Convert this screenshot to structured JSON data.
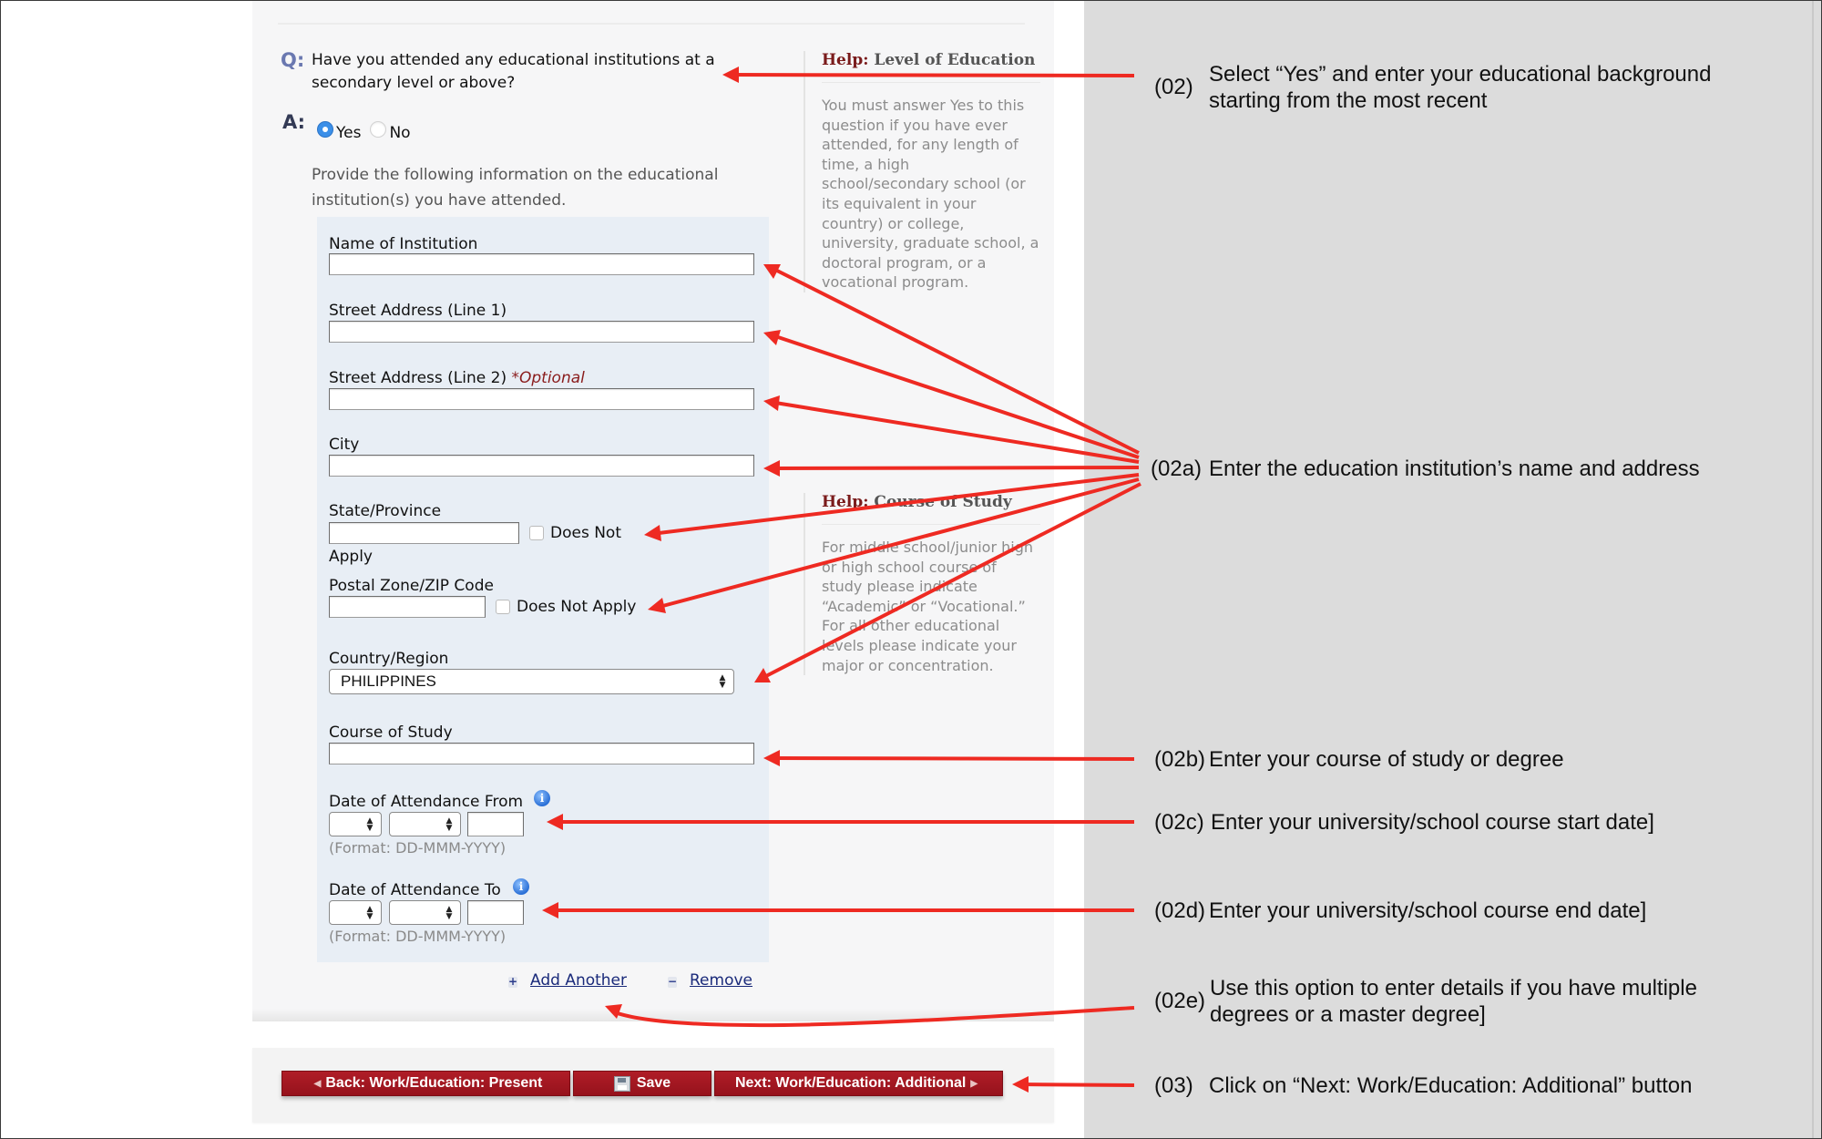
{
  "form": {
    "question_label": "Q:",
    "question": "Have you attended any educational institutions at a secondary level or above?",
    "answer_label": "A:",
    "options": [
      {
        "label": "Yes",
        "selected": true
      },
      {
        "label": "No",
        "selected": false
      }
    ],
    "instructions": "Provide the following information on the educational institution(s) you have attended.",
    "fields": {
      "institution_name": {
        "label": "Name of Institution",
        "value": ""
      },
      "street1": {
        "label": "Street Address (Line 1)",
        "value": ""
      },
      "street2": {
        "label": "Street Address (Line 2)",
        "optional_tag": "*Optional",
        "value": ""
      },
      "city": {
        "label": "City",
        "value": ""
      },
      "state": {
        "label": "State/Province",
        "value": "",
        "does_not_apply_label_1": "Does Not",
        "does_not_apply_label_2": "Apply",
        "does_not_apply_checked": false
      },
      "postal": {
        "label": "Postal Zone/ZIP Code",
        "value": "",
        "does_not_apply_label": "Does Not Apply",
        "does_not_apply_checked": false
      },
      "country": {
        "label": "Country/Region",
        "value": "PHILIPPINES"
      },
      "course": {
        "label": "Course of Study",
        "value": ""
      },
      "date_from": {
        "label": "Date of Attendance From",
        "day": "",
        "month": "",
        "year": "",
        "format_hint": "(Format: DD-MMM-YYYY)"
      },
      "date_to": {
        "label": "Date of Attendance To",
        "day": "",
        "month": "",
        "year": "",
        "format_hint": "(Format: DD-MMM-YYYY)"
      }
    },
    "add_another": "Add Another",
    "remove": "Remove"
  },
  "help": [
    {
      "prefix": "Help:",
      "title": "Level of Education",
      "body": "You must answer Yes to this question if you have ever attended, for any length of time, a high school/secondary school (or its equivalent in your country) or college, university, graduate school, a doctoral program, or a vocational program."
    },
    {
      "prefix": "Help:",
      "title": "Course of Study",
      "body": "For middle school/junior high or high school course of study please indicate “Academic” or “Vocational.” For all other educational levels please indicate your major or concentration."
    }
  ],
  "nav": {
    "back": "Back: Work/Education: Present",
    "save": "Save",
    "next": "Next: Work/Education: Additional"
  },
  "annotations": [
    {
      "id": "(02)",
      "text_1": "Select “Yes” and enter your educational background",
      "text_2": "starting from the most recent"
    },
    {
      "id": "(02a)",
      "text_1": "Enter the education institution’s name and address"
    },
    {
      "id": "(02b)",
      "text_1": "Enter your course of study or degree"
    },
    {
      "id": "(02c)",
      "text_1": "Enter your university/school course start date]"
    },
    {
      "id": "(02d)",
      "text_1": "Enter your university/school course end date]"
    },
    {
      "id": "(02e)",
      "text_1": "Use this option to enter details if you have multiple",
      "text_2": "degrees or a master degree]"
    },
    {
      "id": "(03)",
      "text_1": "Click on “Next: Work/Education: Additional” button"
    }
  ],
  "colors": {
    "arrow": "#ee2a22",
    "button": "#a5161f",
    "help_keyword": "#7a1b1b",
    "radio_selected": "#3b8fe8",
    "annotation_panel": "#dcdcdc"
  }
}
